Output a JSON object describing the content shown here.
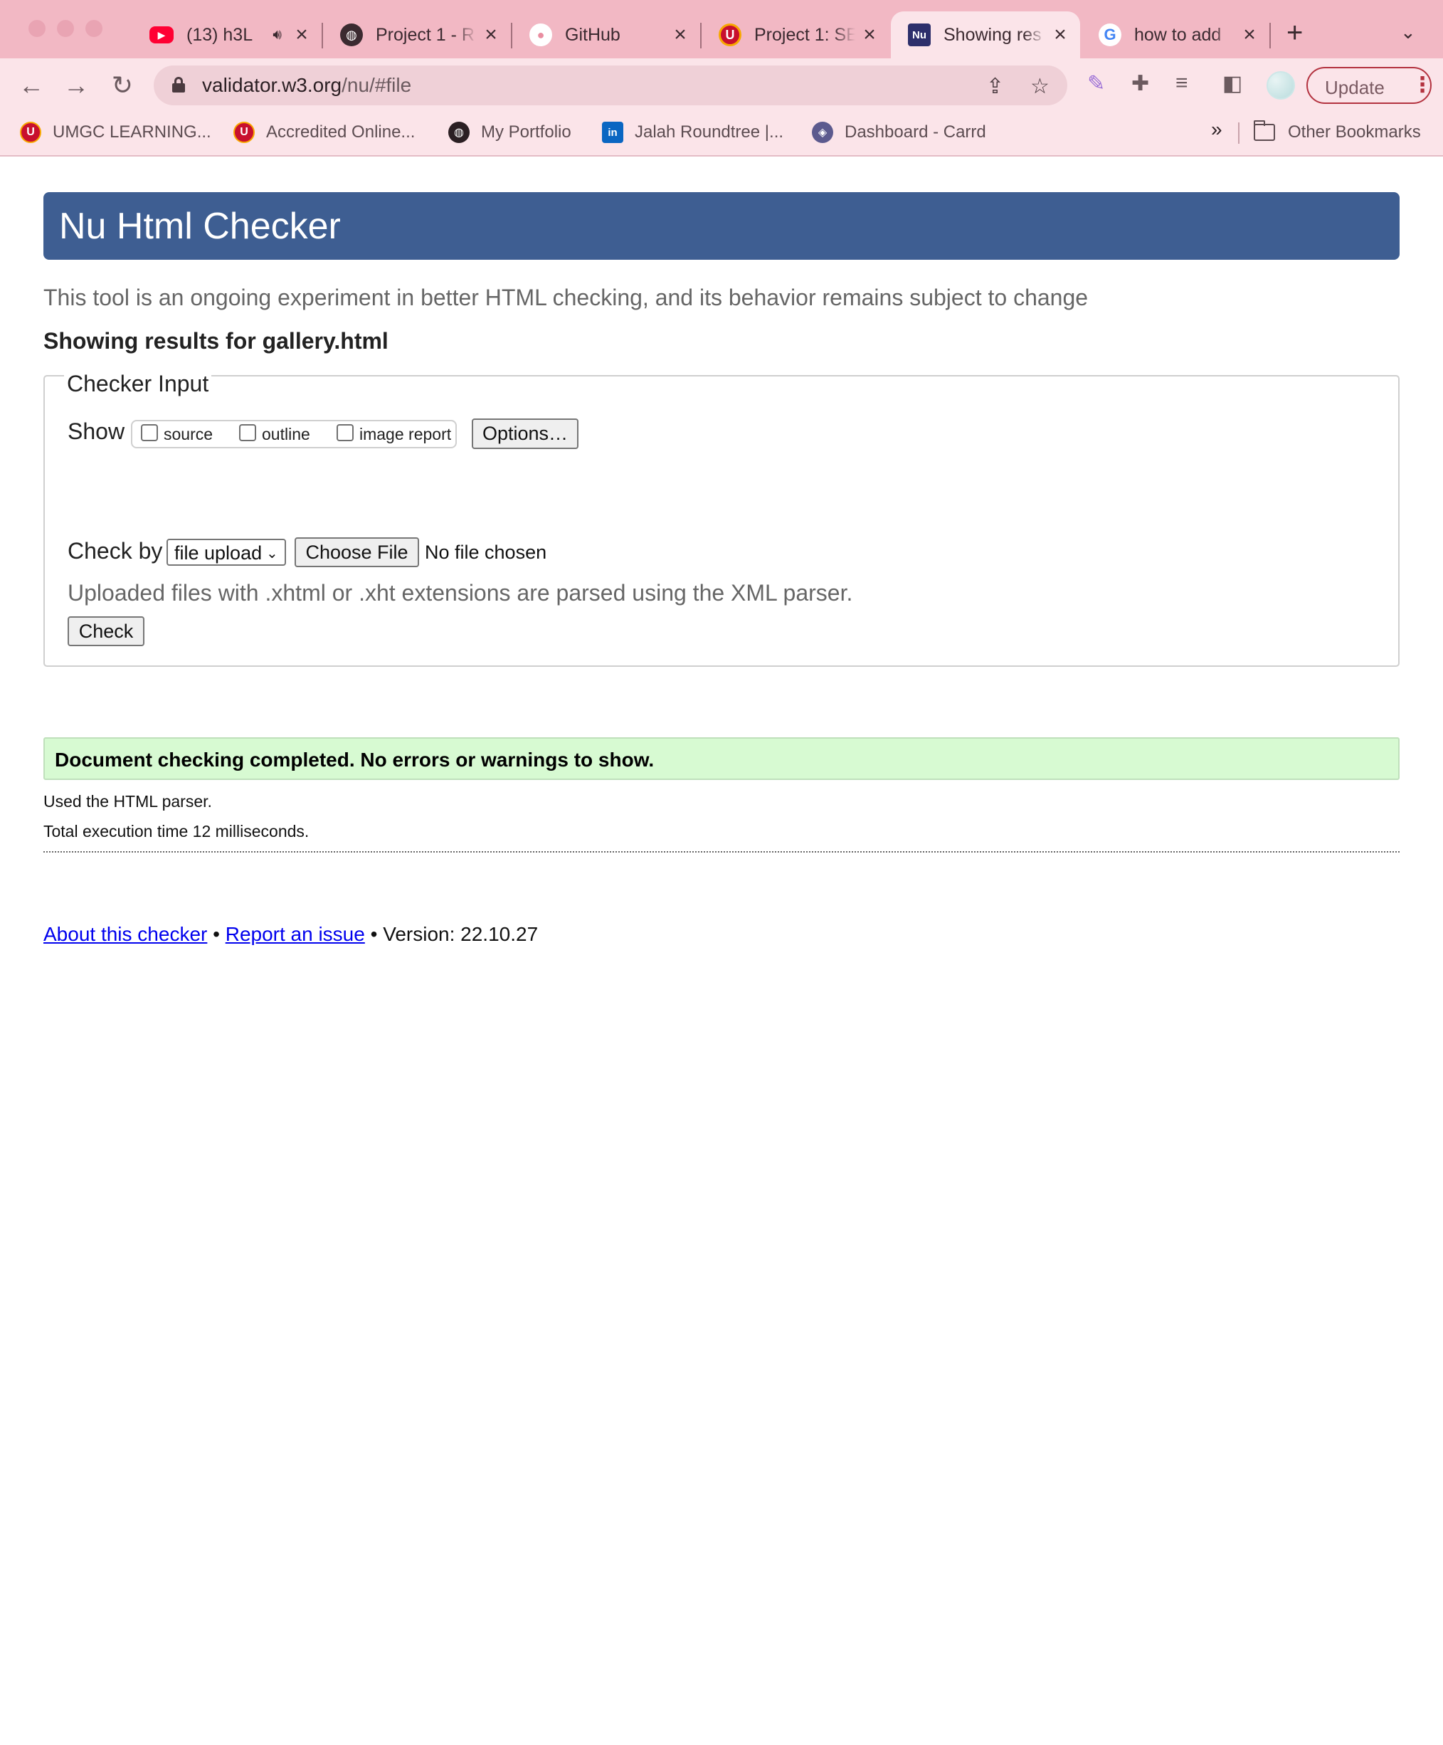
{
  "browser": {
    "tabs": [
      {
        "title": "(13) h3L",
        "favicon": "youtube-icon",
        "color": "#ff0033",
        "playing_audio": true
      },
      {
        "title": "Project 1 - R",
        "favicon": "globe-icon",
        "color": "#3b2a30"
      },
      {
        "title": "GitHub",
        "favicon": "github-icon",
        "color": "#ffffff"
      },
      {
        "title": "Project 1: SE",
        "favicon": "umgc-icon",
        "color": "#c8102e"
      },
      {
        "title": "Showing res",
        "favicon": "w3c-validator-icon",
        "color": "#2d2f6b",
        "active": true
      },
      {
        "title": "how to add",
        "favicon": "google-icon",
        "color": "#4285f4"
      }
    ],
    "address_bar": {
      "domain": "validator.w3.org",
      "path": "/nu/#file"
    },
    "update_label": "Update",
    "bookmarks": [
      {
        "label": "UMGC LEARNING...",
        "icon": "umgc-icon"
      },
      {
        "label": "Accredited Online...",
        "icon": "umgc-icon"
      },
      {
        "label": "My Portfolio",
        "icon": "globe-icon"
      },
      {
        "label": "Jalah Roundtree |...",
        "icon": "linkedin-icon"
      },
      {
        "label": "Dashboard - Carrd",
        "icon": "carrd-icon"
      }
    ],
    "other_bookmarks_label": "Other Bookmarks",
    "more_bookmarks_label": "»"
  },
  "page": {
    "title": "Nu Html Checker",
    "intro": "This tool is an ongoing experiment in better HTML checking, and its behavior remains subject to change",
    "results_heading": "Showing results for gallery.html",
    "checker_input": {
      "legend": "Checker Input",
      "show_label": "Show",
      "show_options": [
        {
          "label": "source",
          "checked": false
        },
        {
          "label": "outline",
          "checked": false
        },
        {
          "label": "image report",
          "checked": false
        }
      ],
      "options_button": "Options…",
      "check_by_label": "Check by",
      "check_by_selected": "file upload",
      "choose_file_button": "Choose File",
      "no_file_text": "No file chosen",
      "xml_note": "Uploaded files with .xhtml or .xht extensions are parsed using the XML parser.",
      "check_button": "Check"
    },
    "status_message": "Document checking completed. No errors or warnings to show.",
    "parser_note": "Used the HTML parser.",
    "execution_time": "Total execution time 12 milliseconds.",
    "footer": {
      "about_link": "About this checker",
      "separator": "•",
      "report_link": "Report an issue",
      "version": "Version: 22.10.27"
    },
    "colors": {
      "header_bg": "#3e5e92",
      "success_bg": "#d7fad2",
      "link": "#0000ee"
    }
  }
}
